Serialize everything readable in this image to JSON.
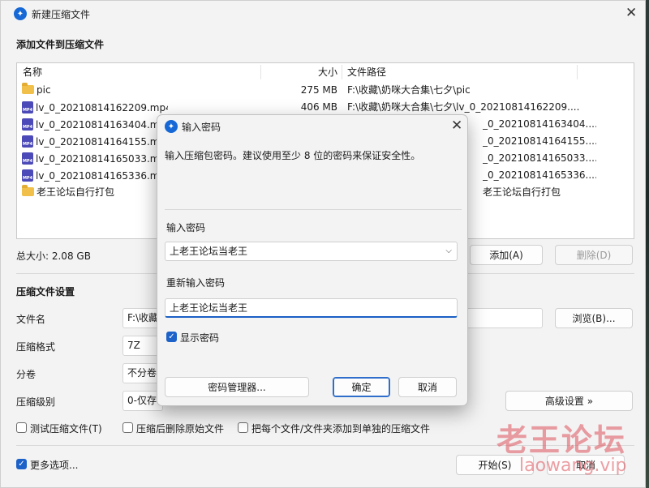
{
  "window": {
    "title": "新建压缩文件",
    "add_files_heading": "添加文件到压缩文件"
  },
  "file_list": {
    "headers": {
      "name": "名称",
      "size": "大小",
      "path": "文件路径"
    },
    "rows": [
      {
        "icon": "folder-icon",
        "name": "pic",
        "size": "275 MB",
        "path": "F:\\收藏\\奶咪大合集\\七夕\\pic"
      },
      {
        "icon": "mp4-file-icon",
        "name": "lv_0_20210814162209.mp4",
        "size": "406 MB",
        "path": "F:\\收藏\\奶咪大合集\\七夕\\lv_0_20210814162209...."
      },
      {
        "icon": "mp4-file-icon",
        "name": "lv_0_20210814163404.mp4",
        "size": "",
        "path": "_0_20210814163404...."
      },
      {
        "icon": "mp4-file-icon",
        "name": "lv_0_20210814164155.mp4",
        "size": "",
        "path": "_0_20210814164155...."
      },
      {
        "icon": "mp4-file-icon",
        "name": "lv_0_20210814165033.mp4",
        "size": "",
        "path": "_0_20210814165033...."
      },
      {
        "icon": "mp4-file-icon",
        "name": "lv_0_20210814165336.mp4",
        "size": "",
        "path": "_0_20210814165336...."
      },
      {
        "icon": "folder-icon",
        "name": "老王论坛自行打包",
        "size": "",
        "path": "老王论坛自行打包"
      }
    ]
  },
  "total_size": "总大小: 2.08 GB",
  "buttons": {
    "add": "添加(A)",
    "delete": "删除(D)",
    "browse": "浏览(B)...",
    "advanced": "高级设置 »",
    "start": "开始(S)",
    "cancel_main": "取消"
  },
  "settings": {
    "heading": "压缩文件设置",
    "filename_label": "文件名",
    "filename_value": "F:\\收藏",
    "format_label": "压缩格式",
    "format_value": "7Z",
    "split_label": "分卷",
    "split_value": "不分卷",
    "level_label": "压缩级别",
    "level_value": "0-仅存"
  },
  "options": {
    "test_archive": "测试压缩文件(T)",
    "delete_after": "压缩后删除原始文件",
    "each_separate": "把每个文件/文件夹添加到单独的压缩文件",
    "more_options": "更多选项..."
  },
  "dialog": {
    "title": "输入密码",
    "description": "输入压缩包密码。建议使用至少 8 位的密码来保证安全性。",
    "password_label": "输入密码",
    "password_value": "上老王论坛当老王",
    "reenter_label": "重新输入密码",
    "reenter_value": "上老王论坛当老王",
    "show_password": "显示密码",
    "password_manager": "密码管理器...",
    "ok": "确定",
    "cancel": "取消"
  },
  "watermark": {
    "text": "老王论坛",
    "url": "laowang.vip"
  },
  "colors": {
    "accent": "#1c62c8",
    "window_bg": "#f3f3f3",
    "watermark": "#dc505a"
  }
}
